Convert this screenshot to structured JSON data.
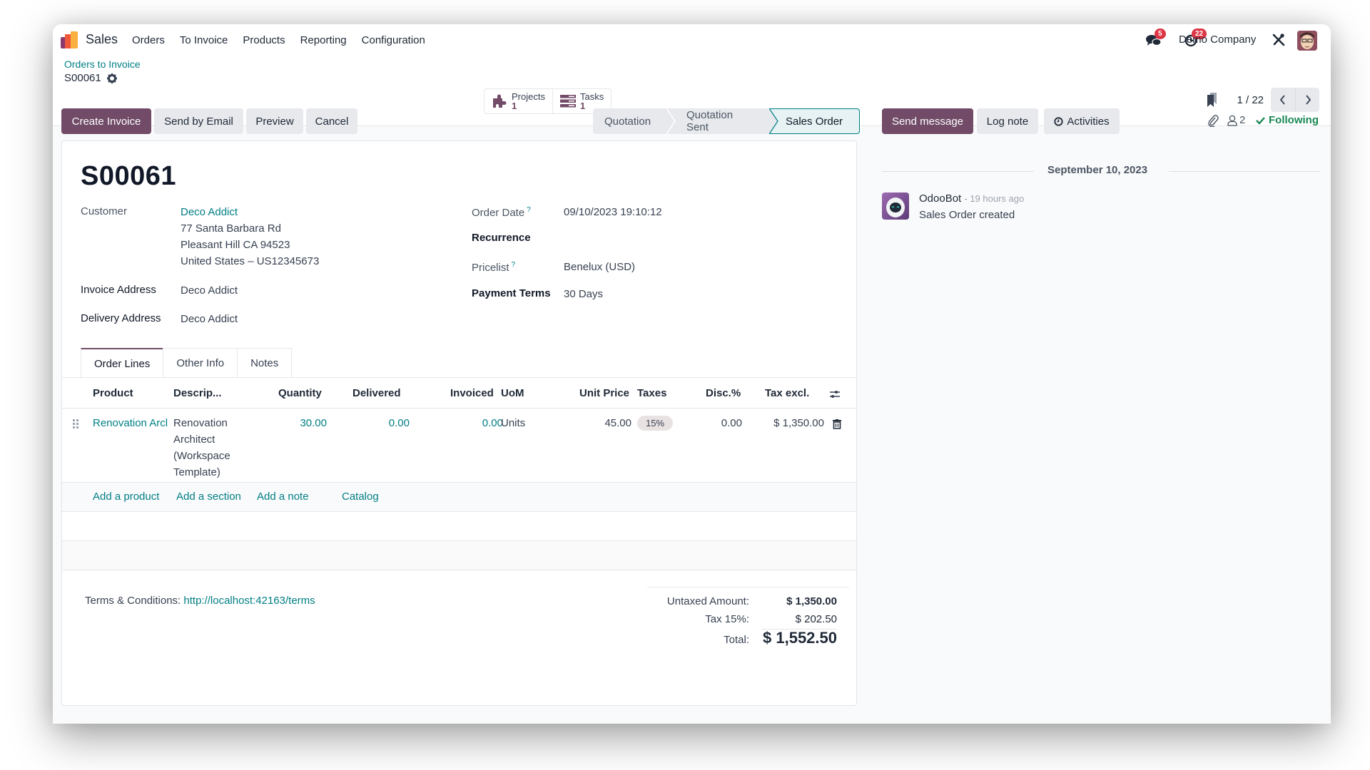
{
  "navbar": {
    "app_name": "Sales",
    "menu": [
      "Orders",
      "To Invoice",
      "Products",
      "Reporting",
      "Configuration"
    ],
    "messages_badge": "5",
    "activities_badge": "22",
    "company": "Demo Company"
  },
  "control_panel": {
    "breadcrumb": "Orders to Invoice",
    "record_name": "S00061",
    "smart_buttons": [
      {
        "label": "Projects",
        "value": "1",
        "icon": "puzzle-icon"
      },
      {
        "label": "Tasks",
        "value": "1",
        "icon": "tasks-icon"
      }
    ],
    "pager": "1 / 22"
  },
  "actions": {
    "create_invoice": "Create Invoice",
    "send_email": "Send by Email",
    "preview": "Preview",
    "cancel": "Cancel"
  },
  "statusbar": {
    "stages": [
      "Quotation",
      "Quotation Sent",
      "Sales Order"
    ],
    "active": "Sales Order"
  },
  "form": {
    "title": "S00061",
    "customer_label": "Customer",
    "customer_name": "Deco Addict",
    "customer_address": [
      "77 Santa Barbara Rd",
      "Pleasant Hill CA 94523",
      "United States – US12345673"
    ],
    "invoice_address_label": "Invoice Address",
    "invoice_address": "Deco Addict",
    "delivery_address_label": "Delivery Address",
    "delivery_address": "Deco Addict",
    "order_date_label": "Order Date",
    "order_date": "09/10/2023 19:10:12",
    "recurrence_label": "Recurrence",
    "pricelist_label": "Pricelist",
    "pricelist": "Benelux (USD)",
    "payment_terms_label": "Payment Terms",
    "payment_terms": "30 Days",
    "help_mark": "?"
  },
  "tabs": [
    "Order Lines",
    "Other Info",
    "Notes"
  ],
  "order_lines": {
    "columns": [
      "Product",
      "Descrip...",
      "Quantity",
      "Delivered",
      "Invoiced",
      "UoM",
      "Unit Price",
      "Taxes",
      "Disc.%",
      "Tax excl."
    ],
    "rows": [
      {
        "product": "Renovation Arcl",
        "description": [
          "Renovation",
          "Architect",
          "(Workspace",
          "Template)"
        ],
        "quantity": "30.00",
        "delivered": "0.00",
        "invoiced": "0.00",
        "uom": "Units",
        "unit_price": "45.00",
        "taxes": "15%",
        "discount": "0.00",
        "subtotal": "$ 1,350.00"
      }
    ],
    "add_links": [
      "Add a product",
      "Add a section",
      "Add a note",
      "Catalog"
    ]
  },
  "footer": {
    "terms_label": "Terms & Conditions:",
    "terms_link": "http://localhost:42163/terms",
    "untaxed_label": "Untaxed Amount:",
    "untaxed_value": "$ 1,350.00",
    "tax_label": "Tax 15%:",
    "tax_value": "$ 202.50",
    "total_label": "Total:",
    "total_value": "$ 1,552.50"
  },
  "chatter": {
    "send_message": "Send message",
    "log_note": "Log note",
    "activities": "Activities",
    "followers_count": "2",
    "following": "Following",
    "date_separator": "September 10, 2023",
    "messages": [
      {
        "author": "OdooBot",
        "time": "- 19 hours ago",
        "body": "Sales Order created"
      }
    ]
  },
  "colors": {
    "primary": "#714b67",
    "link": "#017e84",
    "following": "#198754",
    "badge": "#dc3545"
  }
}
